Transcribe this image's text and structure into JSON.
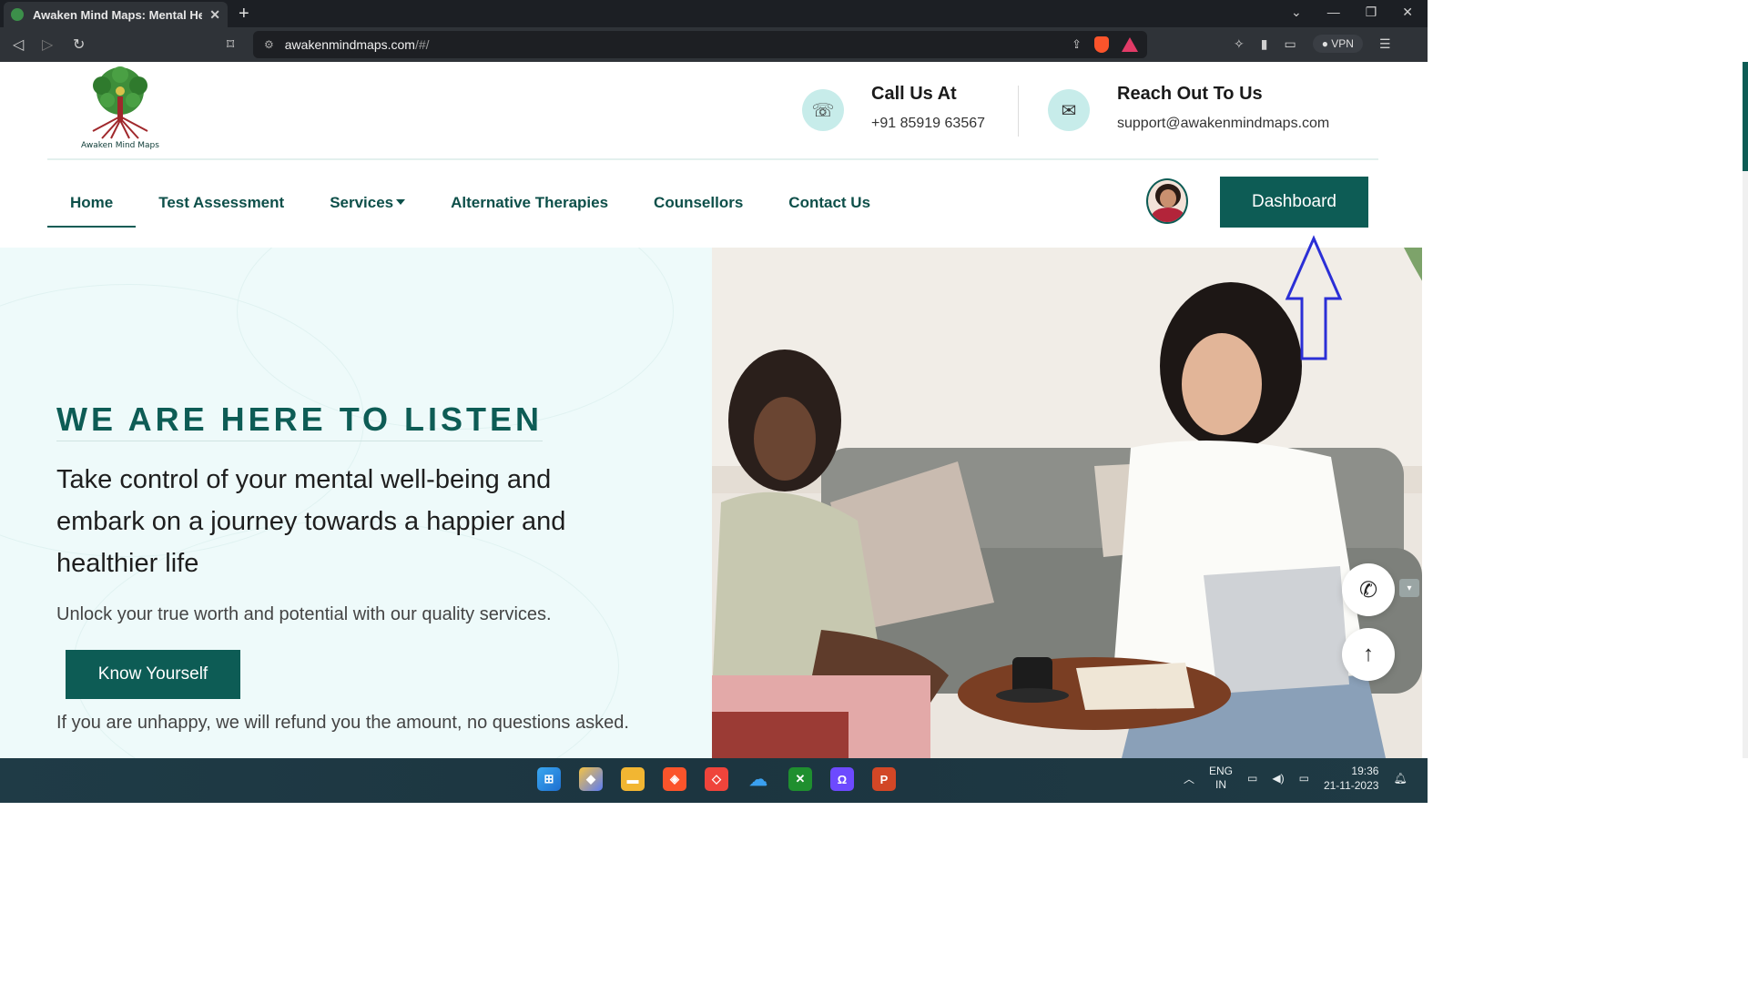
{
  "browser": {
    "tab_title": "Awaken Mind Maps: Mental Heal",
    "tab_close": "✕",
    "new_tab": "+",
    "url_host": "awakenmindmaps.com",
    "url_path": "/#/",
    "vpn_label": "VPN"
  },
  "site": {
    "logo_text": "Awaken Mind Maps",
    "call": {
      "title": "Call Us At",
      "value": "+91 85919 63567"
    },
    "reach": {
      "title": "Reach Out To Us",
      "value": "support@awakenmindmaps.com"
    },
    "nav": {
      "home": "Home",
      "test_assessment": "Test Assessment",
      "services": "Services",
      "alternative_therapies": "Alternative Therapies",
      "counsellors": "Counsellors",
      "contact_us": "Contact Us"
    },
    "dashboard_label": "Dashboard"
  },
  "hero": {
    "heading": "WE ARE HERE TO LISTEN",
    "subheading": "Take control of your mental well-being and embark on a journey towards a happier and healthier life",
    "description": "Unlock your true worth and potential with our quality services.",
    "cta_label": "Know Yourself",
    "refund_note": "If you are unhappy, we will refund you the amount, no questions asked."
  },
  "taskbar": {
    "lang_top": "ENG",
    "lang_bottom": "IN",
    "time": "19:36",
    "date": "21-11-2023"
  },
  "colors": {
    "brand": "#0d5c55",
    "hero_bg": "#eefafa",
    "icon_bg": "#c7ecea",
    "annotation_arrow": "#2b2fd6"
  }
}
